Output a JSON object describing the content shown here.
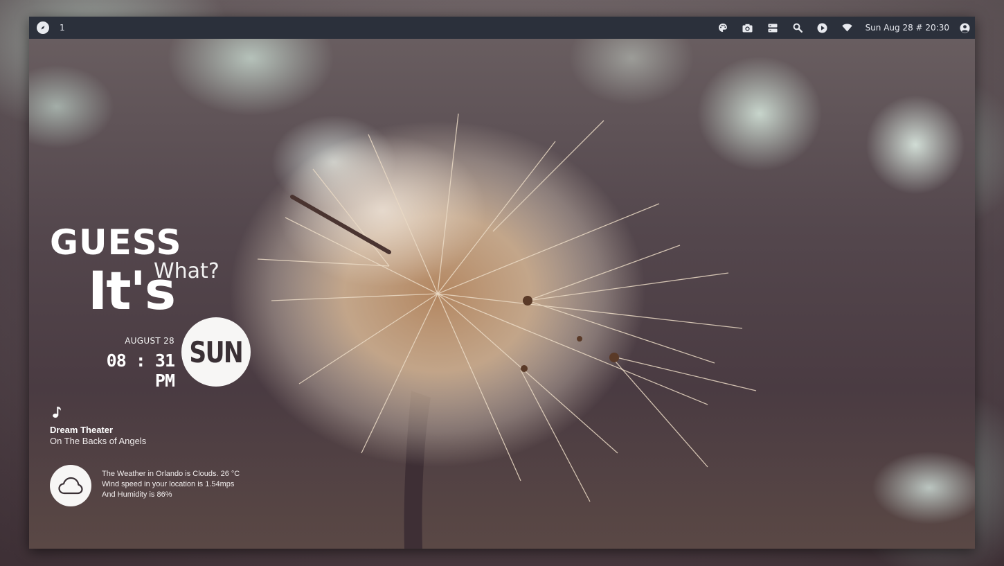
{
  "topbar": {
    "workspace": "1",
    "clock": "Sun Aug 28 # 20:30",
    "icons": [
      "compass-icon",
      "palette-icon",
      "camera-icon",
      "server-icon",
      "search-icon",
      "play-icon",
      "wifi-icon",
      "user-icon"
    ],
    "background_color": "#2b303b"
  },
  "widget": {
    "guess": "GUESS",
    "its": "It's",
    "what": "What?",
    "date": "AUGUST 28",
    "time": "08 : 31 PM",
    "day": "SUN"
  },
  "music": {
    "icon": "music-note-icon",
    "artist": "Dream Theater",
    "song": "On The Backs of Angels"
  },
  "weather": {
    "icon": "cloud-icon",
    "line1": "The Weather in Orlando is Clouds. 26 °C",
    "line2": "Wind speed in your location is 1.54mps",
    "line3": "And Humidity is 86%"
  }
}
